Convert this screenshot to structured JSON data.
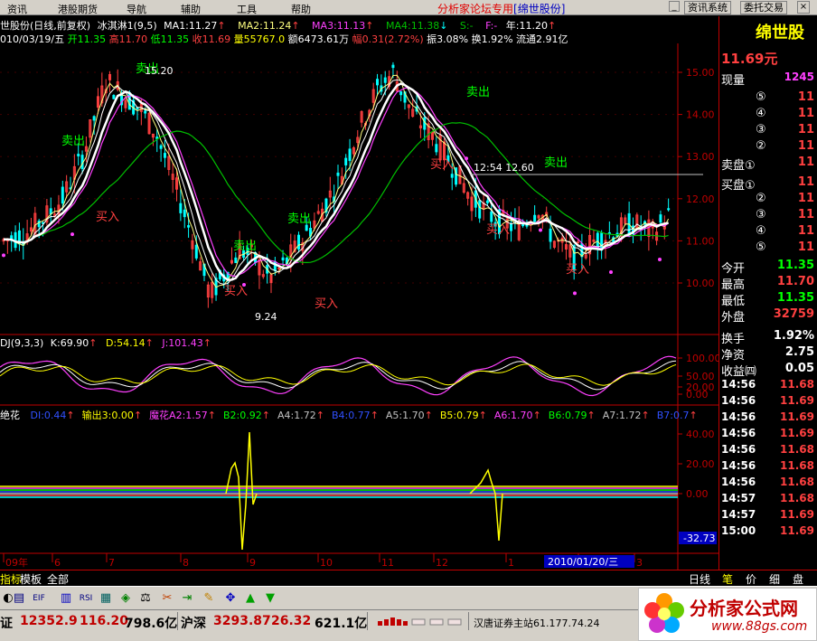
{
  "menu": {
    "items": [
      "资讯",
      "港股期货",
      "导航",
      "辅助",
      "工具",
      "帮助"
    ],
    "title": "分析家论坛专用",
    "stock_tag": "[绵世股份]",
    "btn_news": "资讯系统",
    "btn_trade": "委托交易"
  },
  "header": {
    "line1": {
      "name": "世股份(日线,前复权)",
      "indicator": "冰淇淋1(9,5)",
      "ma1": "MA1:11.27",
      "ma2": "MA2:11.24",
      "ma3": "MA3:11.13",
      "ma4": "MA4:11.38",
      "s": "S:-",
      "f": "F:-",
      "year": "年:11.20"
    },
    "line2": {
      "date": "010/03/19/五",
      "open": "开11.35",
      "high": "高11.70",
      "low": "低11.35",
      "close": "收11.69",
      "vol": "量55767.0",
      "amount": "额6473.61万",
      "change": "幅0.31(2.72%)",
      "amplitude": "振3.08%",
      "turnover": "换1.92%",
      "float": "流通2.91亿"
    }
  },
  "price_axis": [
    "15.00",
    "14.00",
    "13.00",
    "12.00",
    "11.00",
    "10.00"
  ],
  "annotations": {
    "sell": "卖出",
    "buy": "买入",
    "high_mark": "15.20",
    "low_mark": "9.24",
    "hline_label": "12:54 12.60"
  },
  "kdj": {
    "title": "DJ(9,3,3)",
    "k": "K:69.90",
    "d": "D:54.14",
    "j": "J:101.43",
    "axis": [
      "100.00",
      "50.00",
      "20.00",
      "0.00"
    ]
  },
  "lower": {
    "title": "绝花",
    "items": [
      {
        "t": "DI:0.44",
        "c": "#3050ff"
      },
      {
        "t": "输出3:0.00",
        "c": "#ffff00"
      },
      {
        "t": "魔花A2:1.57",
        "c": "#ff40ff"
      },
      {
        "t": "B2:0.92",
        "c": "#00ff00"
      },
      {
        "t": "A4:1.72",
        "c": "#c0c0c0"
      },
      {
        "t": "B4:0.77",
        "c": "#3050ff"
      },
      {
        "t": "A5:1.70",
        "c": "#c0c0c0"
      },
      {
        "t": "B5:0.79",
        "c": "#ffff00"
      },
      {
        "t": "A6:1.70",
        "c": "#ff40ff"
      },
      {
        "t": "B6:0.79",
        "c": "#00ff00"
      },
      {
        "t": "A7:1.72",
        "c": "#c0c0c0"
      },
      {
        "t": "B7:0.7",
        "c": "#3050ff"
      }
    ],
    "axis": [
      "40.00",
      "20.00",
      "0.00"
    ],
    "current": "-32.73"
  },
  "months": [
    "09年",
    "6",
    "7",
    "8",
    "9",
    "10",
    "11",
    "12",
    "1",
    "2",
    "3"
  ],
  "cursor_date": "2010/01/20/三",
  "bottom_tabs": [
    "指标",
    "模板",
    "全部"
  ],
  "period": "日线",
  "right_panel": {
    "name": "绵世股",
    "price": "11.69元",
    "vol_label": "现量",
    "vol_value": "1245",
    "sell_levels": [
      {
        "l": "⑤",
        "v": "11"
      },
      {
        "l": "④",
        "v": "11"
      },
      {
        "l": "③",
        "v": "11"
      },
      {
        "l": "②",
        "v": "11"
      },
      {
        "l": "卖盘①",
        "v": "11"
      }
    ],
    "buy_levels": [
      {
        "l": "买盘①",
        "v": "11"
      },
      {
        "l": "②",
        "v": "11"
      },
      {
        "l": "③",
        "v": "11"
      },
      {
        "l": "④",
        "v": "11"
      },
      {
        "l": "⑤",
        "v": "11"
      }
    ],
    "stats": [
      {
        "l": "今开",
        "v": "11.35",
        "c": "#00ff00"
      },
      {
        "l": "最高",
        "v": "11.70",
        "c": "#ff4040"
      },
      {
        "l": "最低",
        "v": "11.35",
        "c": "#00ff00"
      },
      {
        "l": "外盘",
        "v": "32759",
        "c": "#ff4040"
      },
      {
        "l": "换手",
        "v": "1.92%",
        "c": "#ffffff"
      },
      {
        "l": "净资",
        "v": "2.75",
        "c": "#ffffff"
      },
      {
        "l": "收益㈣",
        "v": "0.05",
        "c": "#ffffff"
      }
    ],
    "trades": [
      {
        "t": "14:56",
        "p": "11.68"
      },
      {
        "t": "14:56",
        "p": "11.69"
      },
      {
        "t": "14:56",
        "p": "11.69"
      },
      {
        "t": "14:56",
        "p": "11.69"
      },
      {
        "t": "14:56",
        "p": "11.68"
      },
      {
        "t": "14:56",
        "p": "11.68"
      },
      {
        "t": "14:56",
        "p": "11.68"
      },
      {
        "t": "14:57",
        "p": "11.68"
      },
      {
        "t": "14:57",
        "p": "11.69"
      },
      {
        "t": "15:00",
        "p": "11.69"
      }
    ],
    "tabs": [
      "笔",
      "价",
      "细",
      "盘"
    ]
  },
  "status": {
    "sz_label": "证",
    "sz_index": "12352.9",
    "sz_change": "116.20",
    "sz_amount": "798.6亿",
    "sh_label": "沪深",
    "sh_index": "3293.87",
    "sh_change": "26.32",
    "sh_amount": "621.1亿",
    "site": "汉唐证券主站61.177.74.24"
  },
  "logo": {
    "name": "分析家公式网",
    "url": "www.88gs.com"
  },
  "colors": {
    "rise": "#ff4040",
    "fall": "#00ffff",
    "ma_white": "#ffffff",
    "ma_yellow": "#ffff80",
    "ma_magenta": "#ff40ff",
    "ma_green": "#00c000"
  }
}
